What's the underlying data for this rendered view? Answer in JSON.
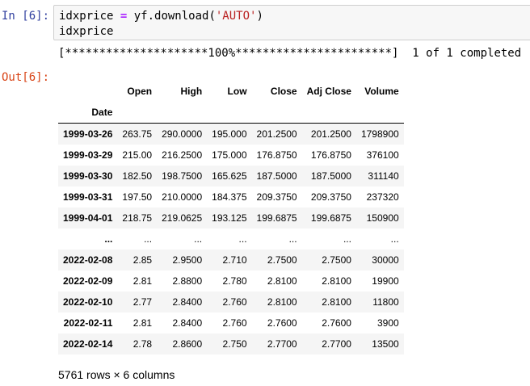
{
  "input": {
    "prompt": "In [6]:",
    "lines": [
      "idxprice = yf.download('AUTO')",
      "idxprice"
    ]
  },
  "stream": "[*********************100%***********************]  1 of 1 completed",
  "output": {
    "prompt": "Out[6]:",
    "index_name": "Date",
    "columns": [
      "Open",
      "High",
      "Low",
      "Close",
      "Adj Close",
      "Volume"
    ],
    "rows": [
      {
        "date": "1999-03-26",
        "open": "263.75",
        "high": "290.0000",
        "low": "195.000",
        "close": "201.2500",
        "adj_close": "201.2500",
        "volume": "1798900"
      },
      {
        "date": "1999-03-29",
        "open": "215.00",
        "high": "216.2500",
        "low": "175.000",
        "close": "176.8750",
        "adj_close": "176.8750",
        "volume": "376100"
      },
      {
        "date": "1999-03-30",
        "open": "182.50",
        "high": "198.7500",
        "low": "165.625",
        "close": "187.5000",
        "adj_close": "187.5000",
        "volume": "311140"
      },
      {
        "date": "1999-03-31",
        "open": "197.50",
        "high": "210.0000",
        "low": "184.375",
        "close": "209.3750",
        "adj_close": "209.3750",
        "volume": "237320"
      },
      {
        "date": "1999-04-01",
        "open": "218.75",
        "high": "219.0625",
        "low": "193.125",
        "close": "199.6875",
        "adj_close": "199.6875",
        "volume": "150900"
      },
      {
        "date": "...",
        "open": "...",
        "high": "...",
        "low": "...",
        "close": "...",
        "adj_close": "...",
        "volume": "..."
      },
      {
        "date": "2022-02-08",
        "open": "2.85",
        "high": "2.9500",
        "low": "2.710",
        "close": "2.7500",
        "adj_close": "2.7500",
        "volume": "30000"
      },
      {
        "date": "2022-02-09",
        "open": "2.81",
        "high": "2.8800",
        "low": "2.780",
        "close": "2.8100",
        "adj_close": "2.8100",
        "volume": "19900"
      },
      {
        "date": "2022-02-10",
        "open": "2.77",
        "high": "2.8400",
        "low": "2.760",
        "close": "2.8100",
        "adj_close": "2.8100",
        "volume": "11800"
      },
      {
        "date": "2022-02-11",
        "open": "2.81",
        "high": "2.8400",
        "low": "2.760",
        "close": "2.7600",
        "adj_close": "2.7600",
        "volume": "3900"
      },
      {
        "date": "2022-02-14",
        "open": "2.78",
        "high": "2.8600",
        "low": "2.750",
        "close": "2.7700",
        "adj_close": "2.7700",
        "volume": "13500"
      }
    ],
    "shape_text": "5761 rows × 6 columns"
  }
}
